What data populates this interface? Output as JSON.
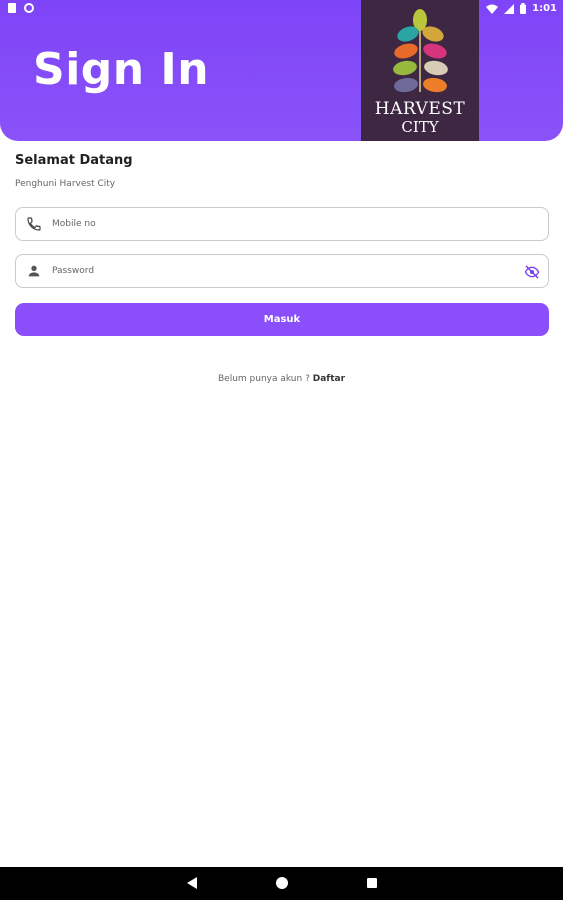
{
  "status_bar": {
    "time": "1:01",
    "icons": [
      "sim-card-icon",
      "sync-icon",
      "wifi-icon",
      "signal-icon",
      "battery-icon"
    ]
  },
  "header": {
    "title": "Sign In",
    "logo": {
      "line1": "HARVEST",
      "line2": "CITY"
    },
    "colors": {
      "accent": "#8a4ffa",
      "logo_bg": "#3e2743"
    }
  },
  "welcome": {
    "heading": "Selamat Datang",
    "subtitle": "Penghuni Harvest City"
  },
  "form": {
    "mobile": {
      "placeholder": "Mobile no",
      "value": "",
      "icon": "phone-icon"
    },
    "password": {
      "placeholder": "Password",
      "value": "",
      "icon": "person-icon",
      "toggle_icon": "eye-off-icon"
    },
    "submit_label": "Masuk"
  },
  "signup": {
    "prompt": "Belum punya akun ?",
    "link": "Daftar"
  },
  "nav": {
    "icons": [
      "back-icon",
      "home-icon",
      "recent-apps-icon"
    ]
  }
}
